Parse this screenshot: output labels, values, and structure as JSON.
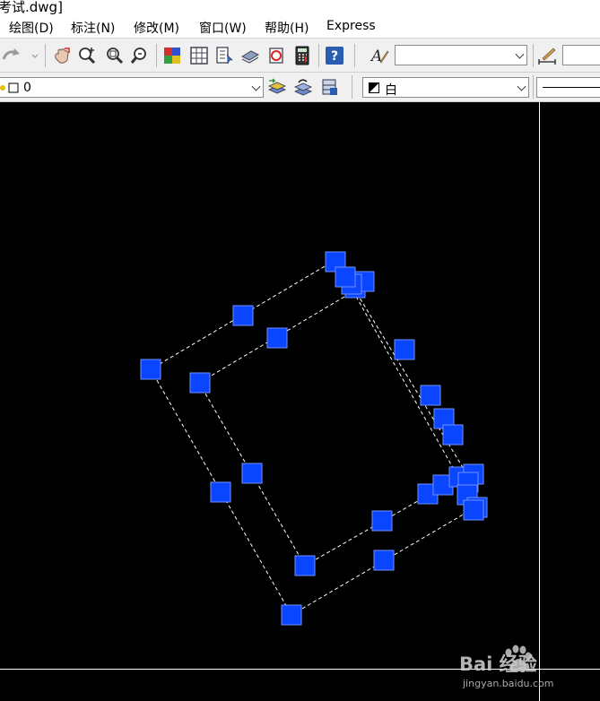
{
  "window": {
    "title_fragment": "考试.dwg]"
  },
  "menu": [
    {
      "label": "绘图(D)"
    },
    {
      "label": "标注(N)"
    },
    {
      "label": "修改(M)"
    },
    {
      "label": "窗口(W)"
    },
    {
      "label": "帮助(H)"
    },
    {
      "label": "Express"
    }
  ],
  "toolbar": {
    "text_style_value": "",
    "dim_style_value": "",
    "layer": {
      "name": "0"
    },
    "color": {
      "name": "白"
    }
  },
  "colors": {
    "grip_fill": "#0a46ff",
    "grip_border": "#7090ff",
    "dash_line": "#ffffff",
    "background": "#000000",
    "crosshair": "#ffffff"
  },
  "drawing": {
    "shape": "two nested dashed quadrilaterals with blue grips",
    "crosshair": "vertical and horizontal cursor lines"
  },
  "watermark": {
    "brand": "Bai 经验",
    "url": "jingyan.baidu.com"
  }
}
